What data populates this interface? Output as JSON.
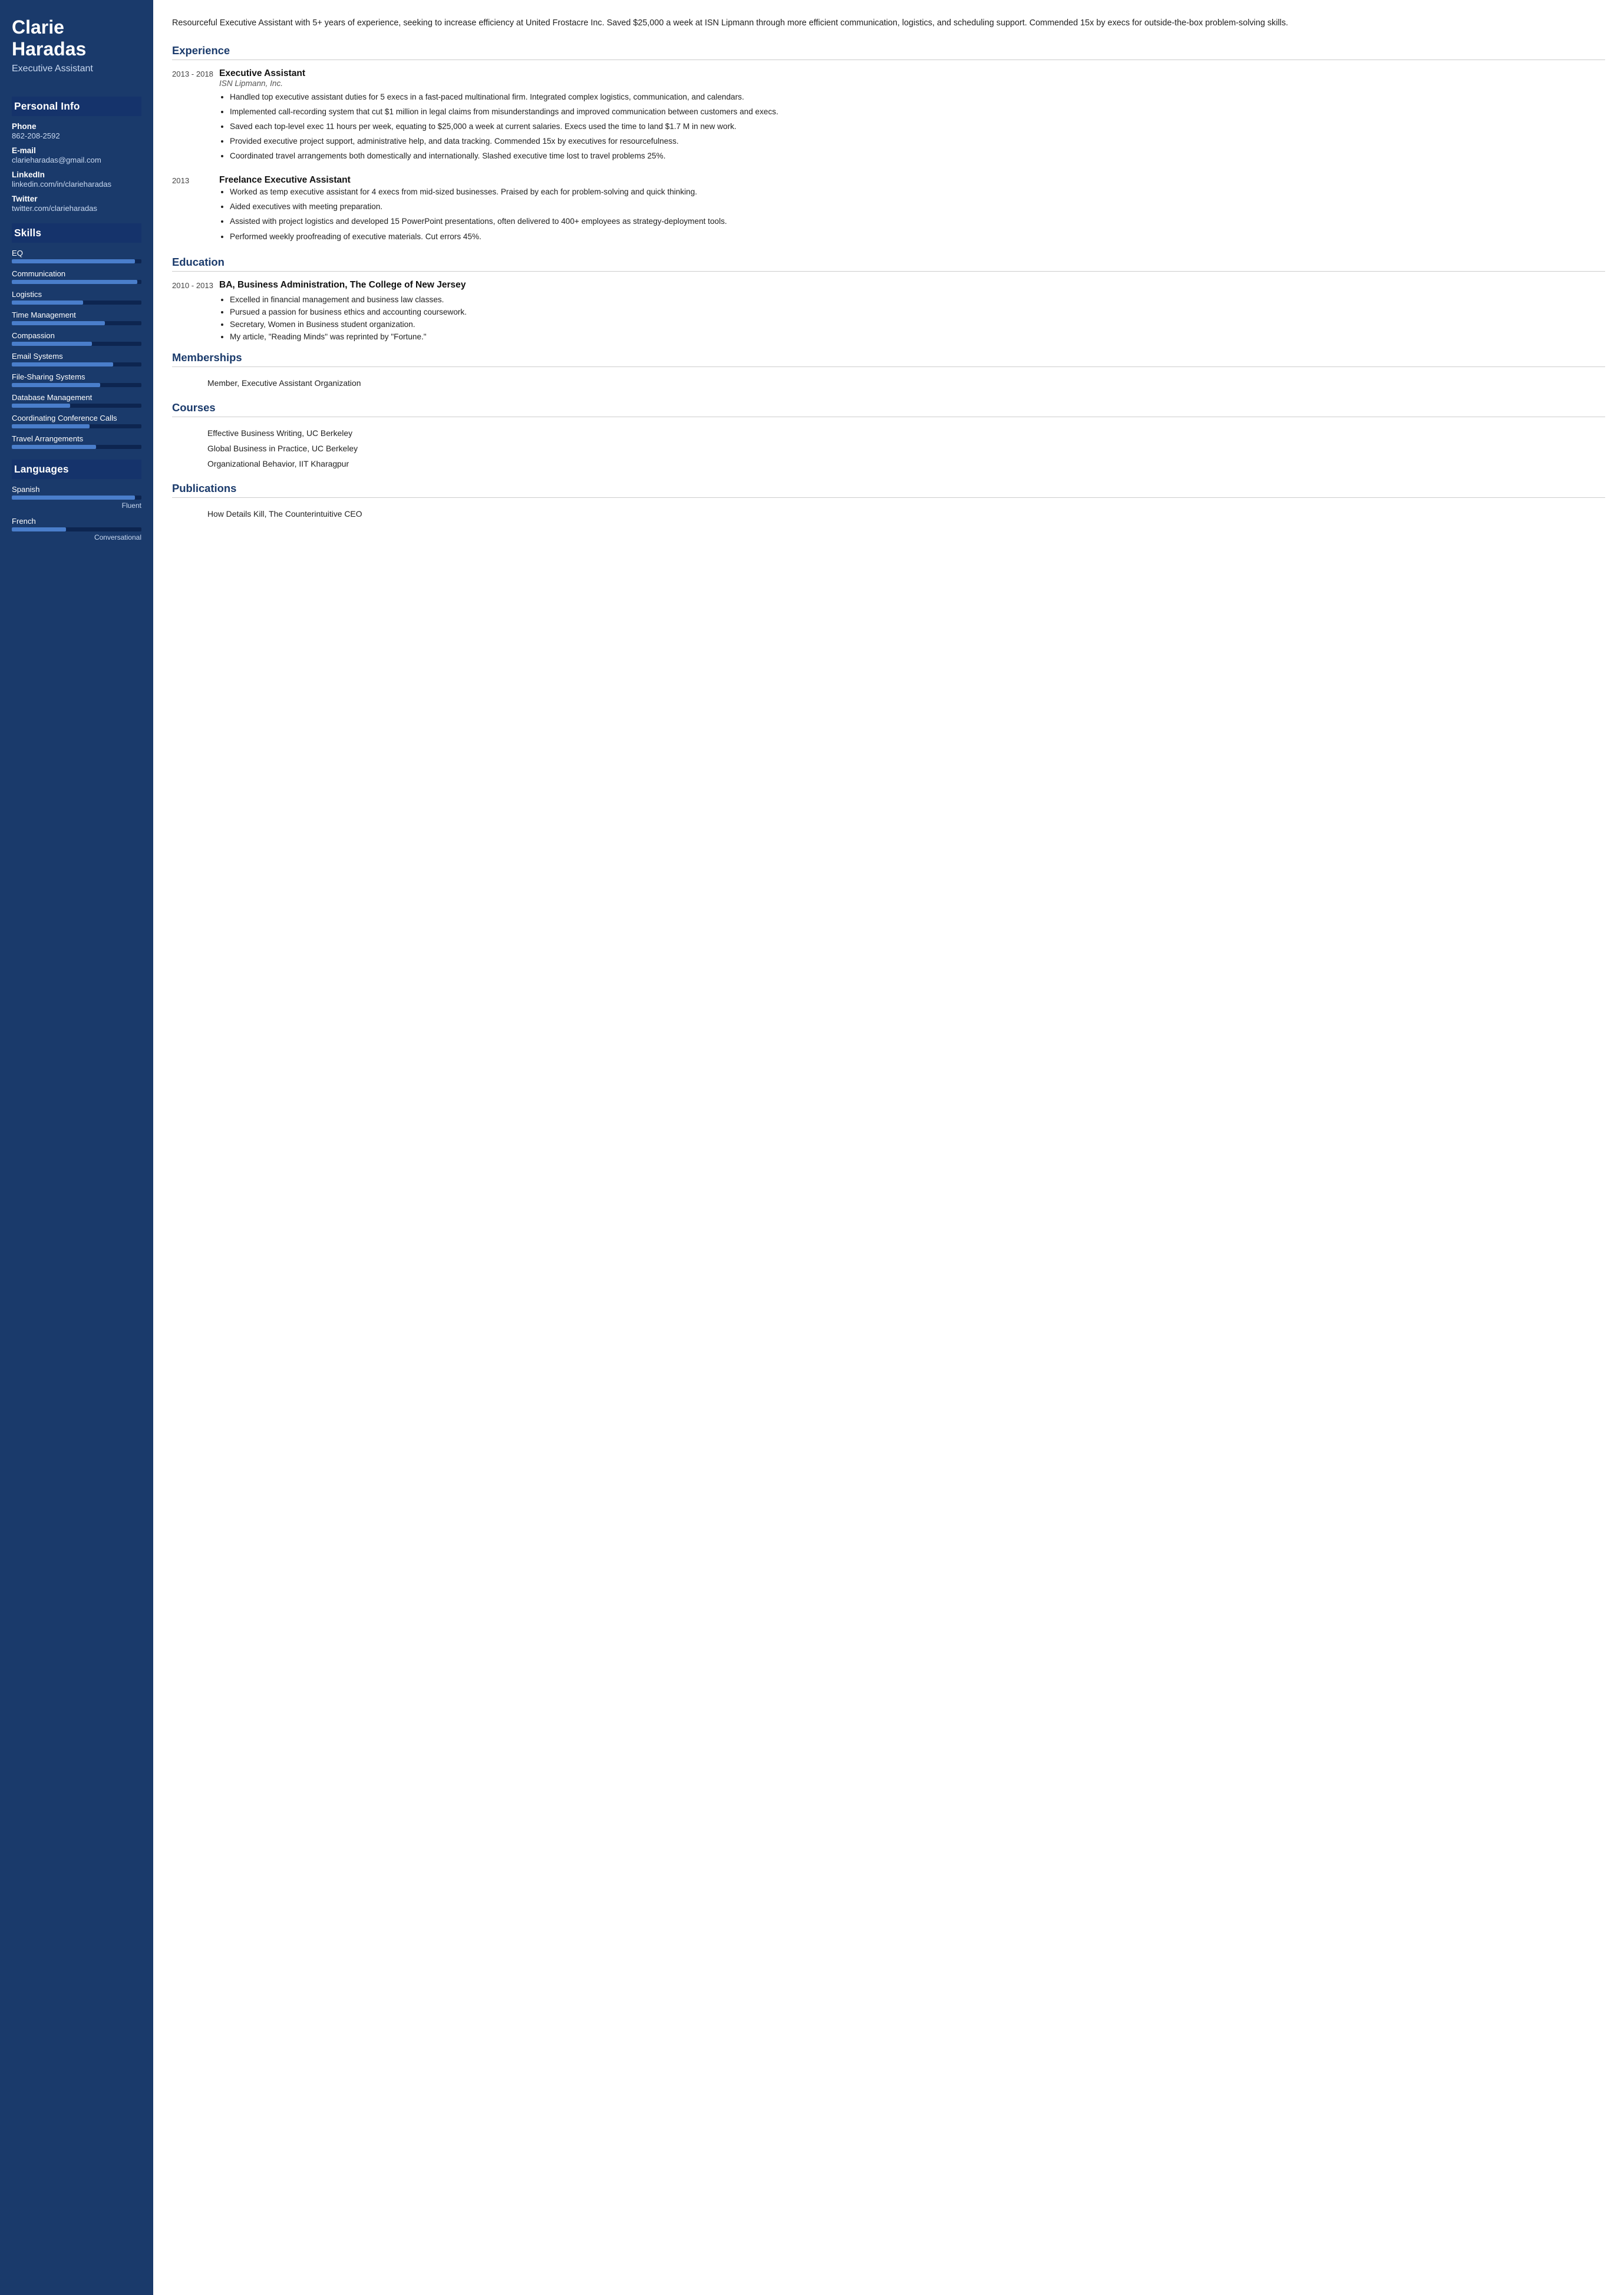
{
  "sidebar": {
    "name": "Clarie Haradas",
    "title": "Executive Assistant",
    "personal_info": {
      "section_title": "Personal Info",
      "fields": [
        {
          "label": "Phone",
          "value": "862-208-2592"
        },
        {
          "label": "E-mail",
          "value": "clarieharadas@gmail.com"
        },
        {
          "label": "LinkedIn",
          "value": "linkedin.com/in/clarieharadas"
        },
        {
          "label": "Twitter",
          "value": "twitter.com/clarieharadas"
        }
      ]
    },
    "skills": {
      "section_title": "Skills",
      "items": [
        {
          "name": "EQ",
          "percent": 95
        },
        {
          "name": "Communication",
          "percent": 97
        },
        {
          "name": "Logistics",
          "percent": 55
        },
        {
          "name": "Time Management",
          "percent": 72
        },
        {
          "name": "Compassion",
          "percent": 62
        },
        {
          "name": "Email Systems",
          "percent": 78
        },
        {
          "name": "File-Sharing Systems",
          "percent": 68
        },
        {
          "name": "Database Management",
          "percent": 45
        },
        {
          "name": "Coordinating Conference Calls",
          "percent": 60
        },
        {
          "name": "Travel Arrangements",
          "percent": 65
        }
      ]
    },
    "languages": {
      "section_title": "Languages",
      "items": [
        {
          "name": "Spanish",
          "percent": 95,
          "level": "Fluent"
        },
        {
          "name": "French",
          "percent": 42,
          "level": "Conversational"
        }
      ]
    }
  },
  "main": {
    "summary": "Resourceful Executive Assistant with 5+ years of experience, seeking to increase efficiency at United Frostacre Inc. Saved $25,000 a week at ISN Lipmann through more efficient communication, logistics, and scheduling support. Commended 15x by execs for outside-the-box problem-solving skills.",
    "experience": {
      "section_title": "Experience",
      "jobs": [
        {
          "dates": "2013 - 2018",
          "title": "Executive Assistant",
          "company": "ISN Lipmann, Inc.",
          "bullets": [
            "Handled top executive assistant duties for 5 execs in a fast-paced multinational firm. Integrated complex logistics, communication, and calendars.",
            "Implemented call-recording system that cut $1 million in legal claims from misunderstandings and improved communication between customers and execs.",
            "Saved each top-level exec 11 hours per week, equating to $25,000 a week at current salaries. Execs used the time to land $1.7 M in new work.",
            "Provided executive project support, administrative help, and data tracking. Commended 15x by executives for resourcefulness.",
            "Coordinated travel arrangements both domestically and internationally. Slashed executive time lost to travel problems 25%."
          ]
        },
        {
          "dates": "2013",
          "title": "Freelance Executive Assistant",
          "company": "",
          "bullets": [
            "Worked as temp executive assistant for 4 execs from mid-sized businesses. Praised by each for problem-solving and quick thinking.",
            "Aided executives with meeting preparation.",
            "Assisted with project logistics and developed 15 PowerPoint presentations, often delivered to 400+ employees as strategy-deployment tools.",
            "Performed weekly proofreading of executive materials. Cut errors 45%."
          ]
        }
      ]
    },
    "education": {
      "section_title": "Education",
      "items": [
        {
          "dates": "2010 - 2013",
          "degree": "BA, Business Administration, The College of New Jersey",
          "bullets": [
            "Excelled in financial management and business law classes.",
            "Pursued a passion for business ethics and accounting coursework.",
            "Secretary, Women in Business student organization.",
            "My article, \"Reading Minds\" was reprinted by \"Fortune.\""
          ]
        }
      ]
    },
    "memberships": {
      "section_title": "Memberships",
      "items": [
        "Member, Executive Assistant Organization"
      ]
    },
    "courses": {
      "section_title": "Courses",
      "items": [
        "Effective Business Writing, UC Berkeley",
        "Global Business in Practice, UC Berkeley",
        "Organizational Behavior, IIT Kharagpur"
      ]
    },
    "publications": {
      "section_title": "Publications",
      "items": [
        "How Details Kill, The Counterintuitive CEO"
      ]
    }
  }
}
